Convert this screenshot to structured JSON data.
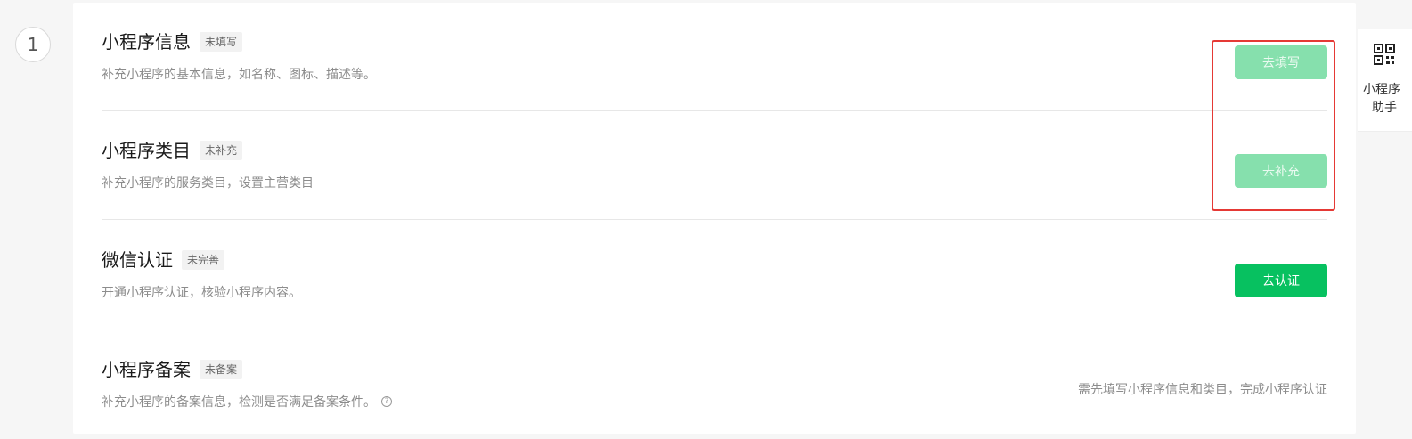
{
  "step": {
    "number": "1"
  },
  "rows": [
    {
      "title": "小程序信息",
      "badge": "未填写",
      "desc": "补充小程序的基本信息，如名称、图标、描述等。",
      "button": "去填写",
      "button_state": "disabled"
    },
    {
      "title": "小程序类目",
      "badge": "未补充",
      "desc": "补充小程序的服务类目，设置主营类目",
      "button": "去补充",
      "button_state": "disabled"
    },
    {
      "title": "微信认证",
      "badge": "未完善",
      "desc": "开通小程序认证，核验小程序内容。",
      "button": "去认证",
      "button_state": "primary"
    },
    {
      "title": "小程序备案",
      "badge": "未备案",
      "desc": "补充小程序的备案信息，检测是否满足备案条件。",
      "note": "需先填写小程序信息和类目，完成小程序认证",
      "help_icon": "question-circle-icon"
    }
  ],
  "side_widget": {
    "icon": "qr-code-icon",
    "line1": "小程序",
    "line2": "助手"
  },
  "colors": {
    "primary": "#07c160",
    "disabled": "#86e0ad",
    "highlight": "#e53935"
  }
}
